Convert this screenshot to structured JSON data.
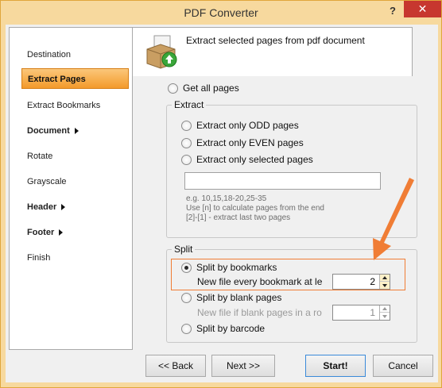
{
  "window": {
    "title": "PDF Converter",
    "help_glyph": "?",
    "close_glyph": "✕"
  },
  "sidebar": {
    "items": [
      {
        "label": "Destination"
      },
      {
        "label": "Extract Pages"
      },
      {
        "label": "Extract Bookmarks"
      },
      {
        "label": "Document"
      },
      {
        "label": "Rotate"
      },
      {
        "label": "Grayscale"
      },
      {
        "label": "Header"
      },
      {
        "label": "Footer"
      },
      {
        "label": "Finish"
      }
    ]
  },
  "header": {
    "title": "Extract selected pages from pdf document"
  },
  "options": {
    "get_all_pages": "Get all pages"
  },
  "extract": {
    "label": "Extract",
    "odd": "Extract only ODD pages",
    "even": "Extract only EVEN pages",
    "selected": "Extract only selected pages",
    "pages_value": "",
    "hint_lines": [
      "e.g. 10,15,18-20,25-35",
      "Use [n] to calculate pages from the end",
      "[2]-[1] - extract last two pages"
    ]
  },
  "split": {
    "label": "Split",
    "by_bookmarks": "Split by bookmarks",
    "bookmark_sub": "New file every bookmark at le",
    "bookmark_value": "2",
    "by_blank": "Split by blank pages",
    "blank_sub": "New file if blank pages in a ro",
    "blank_value": "1",
    "by_barcode": "Split by barcode"
  },
  "buttons": {
    "back": "<< Back",
    "next": "Next >>",
    "start": "Start!",
    "cancel": "Cancel"
  },
  "colors": {
    "accent": "#f39a2b",
    "highlight": "#f07d35",
    "close": "#c7372f"
  }
}
